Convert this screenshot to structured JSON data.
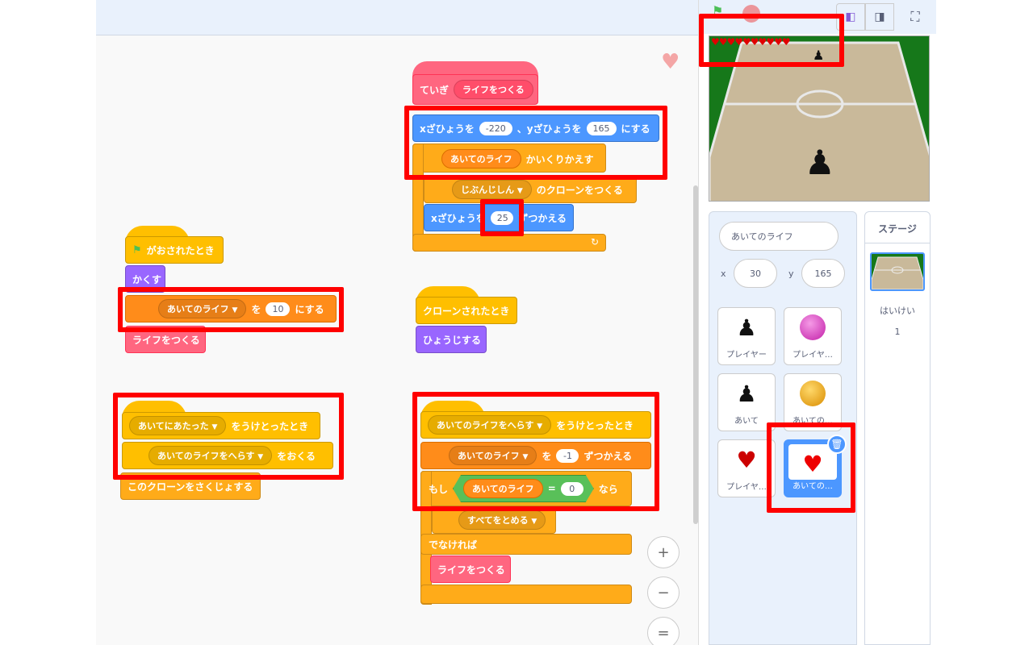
{
  "workspace": {
    "blocks": {
      "green_flag": "がおされたとき",
      "hide": "かくす",
      "set_life_var": "あいてのライフ",
      "set_wo": "を",
      "set_value": "10",
      "set_suffix": "にする",
      "make_life_call1": "ライフをつくる",
      "receive_hit_msg": "あいてにあたった",
      "receive_suffix": "をうけとったとき",
      "send_msg": "あいてのライフをへらす",
      "send_suffix": "をおくる",
      "delete_clone": "このクローンをさくじょする",
      "define_prefix": "ていぎ",
      "define_name": "ライフをつくる",
      "goto_x_label": "xざひょうを",
      "goto_x_value": "-220",
      "goto_sep": "、yざひょうを",
      "goto_y_value": "165",
      "goto_suffix": "にする",
      "repeat_var": "あいてのライフ",
      "repeat_suffix": "かいくりかえす",
      "clone_target": "じぶんじしん",
      "clone_suffix": "のクローンをつくる",
      "change_x_label": "xざひょうを",
      "change_x_value": "25",
      "change_x_suffix": "ずつかえる",
      "clone_start": "クローンされたとき",
      "show": "ひょうじする",
      "receive_reduce_msg": "あいてのライフをへらす",
      "receive_reduce_suffix": "をうけとったとき",
      "change_var": "あいてのライフ",
      "change_wo": "を",
      "change_value": "-1",
      "change_suffix": "ずつかえる",
      "if_label": "もし",
      "if_var": "あいてのライフ",
      "if_eq": "=",
      "if_value": "0",
      "if_then": "なら",
      "stop_option": "すべてをとめる",
      "else_label": "でなければ",
      "make_life_call2": "ライフをつくる"
    },
    "zoom": {
      "in": "+",
      "out": "−",
      "reset": "="
    }
  },
  "sprite_info": {
    "name": "あいてのライフ",
    "x_label": "x",
    "x_value": "30",
    "y_label": "y",
    "y_value": "165"
  },
  "sprites": [
    {
      "label": "プレイヤー",
      "icon": "player-figure-icon"
    },
    {
      "label": "プレイヤ…",
      "icon": "pink-ball-icon"
    },
    {
      "label": "あいて",
      "icon": "opponent-figure-icon"
    },
    {
      "label": "あいての…",
      "icon": "orange-ball-icon"
    },
    {
      "label": "プレイヤ…",
      "icon": "heart-icon"
    },
    {
      "label": "あいての…",
      "icon": "heart-icon"
    }
  ],
  "stage_pane": {
    "title": "ステージ",
    "backdrop_label": "はいけい",
    "backdrop_count": "1"
  },
  "stage": {
    "hearts": "♥♥♥♥♥♥♥♥♥♥"
  },
  "colors": {
    "events": "#ffbf00",
    "control": "#ffab19",
    "motion": "#4c97ff",
    "variables": "#ff8c1a",
    "looks": "#9966ff",
    "my_blocks": "#ff6680",
    "highlight": "#ff0000"
  }
}
